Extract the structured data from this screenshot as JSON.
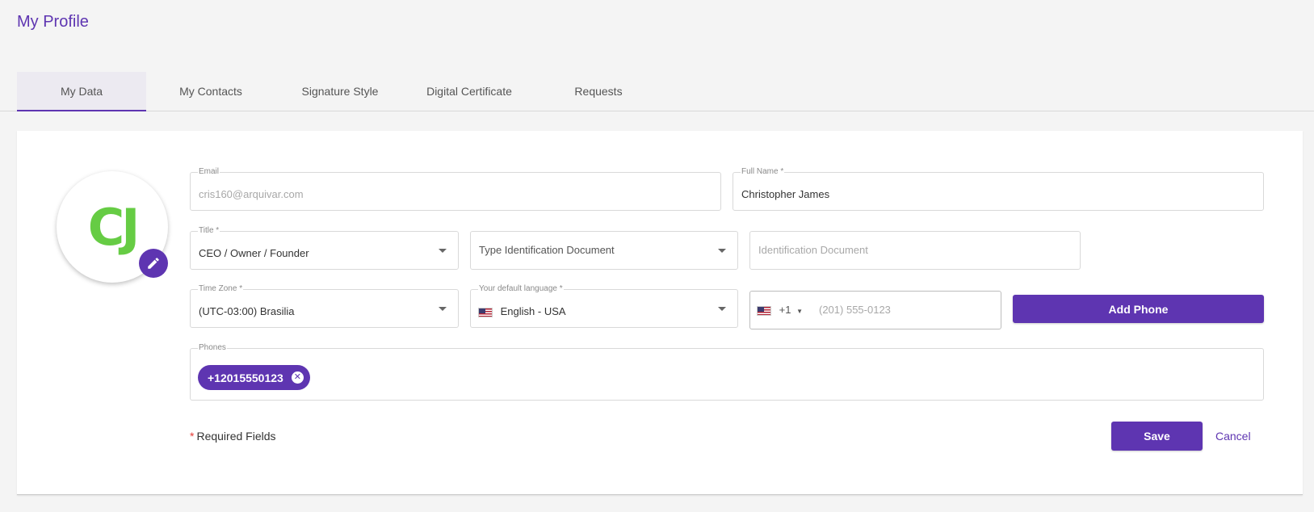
{
  "page": {
    "title": "My Profile"
  },
  "tabs": [
    {
      "label": "My Data",
      "active": true
    },
    {
      "label": "My Contacts"
    },
    {
      "label": "Signature Style"
    },
    {
      "label": "Digital Certificate"
    },
    {
      "label": "Requests"
    }
  ],
  "avatar": {
    "initials": "CJ",
    "edit_icon": "pencil-icon"
  },
  "form": {
    "email": {
      "label": "Email",
      "value": "cris160@arquivar.com"
    },
    "full_name": {
      "label": "Full Name *",
      "value": "Christopher James"
    },
    "title": {
      "label": "Title *",
      "value": "CEO / Owner / Founder"
    },
    "id_doc_type": {
      "placeholder": "Type Identification Document"
    },
    "id_doc": {
      "placeholder": "Identification Document"
    },
    "time_zone": {
      "label": "Time Zone *",
      "value": "(UTC-03:00) Brasilia"
    },
    "language": {
      "label": "Your default language *",
      "value": "English - USA",
      "flag": "us-flag-icon"
    },
    "phone": {
      "country_code": "+1",
      "placeholder": "(201) 555-0123",
      "flag": "us-flag-icon"
    },
    "add_phone_label": "Add Phone",
    "phones": {
      "label": "Phones",
      "items": [
        "+12015550123"
      ]
    },
    "required_text": "Required Fields",
    "required_mark": "*",
    "save_label": "Save",
    "cancel_label": "Cancel"
  },
  "colors": {
    "accent": "#5e35b1",
    "avatar_initials": "#66cc44",
    "required": "#e53935"
  }
}
